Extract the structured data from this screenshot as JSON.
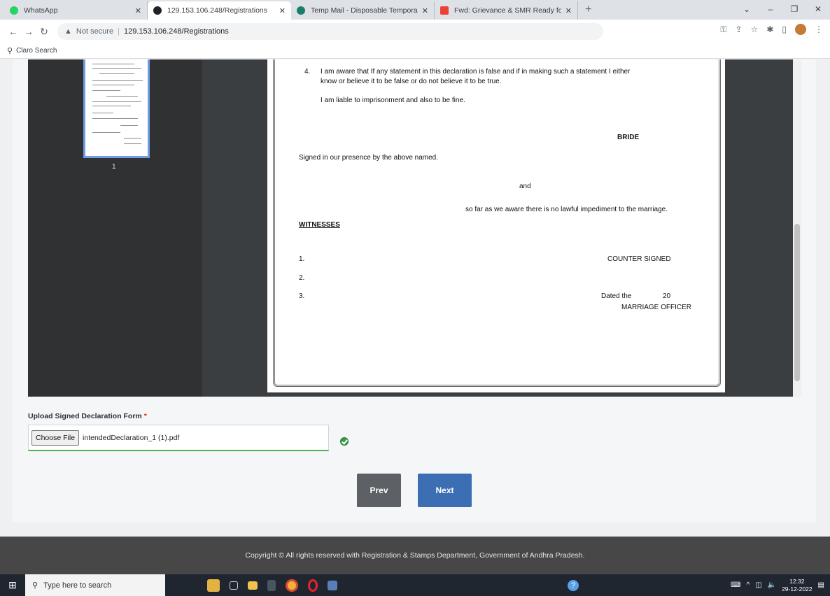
{
  "tabs": [
    {
      "title": "WhatsApp",
      "color": "#25d366"
    },
    {
      "title": "129.153.106.248/Registrations",
      "color": "#202124"
    },
    {
      "title": "Temp Mail - Disposable Tempora",
      "color": "#17806d"
    },
    {
      "title": "Fwd: Grievance & SMR Ready for",
      "color": "#ea4335"
    }
  ],
  "address": {
    "security": "Not secure",
    "url": "129.153.106.248/Registrations"
  },
  "bookmarks": {
    "item": "Claro Search"
  },
  "document": {
    "item4_num": "4.",
    "item4_line1": "I am aware that If any statement in this declaration is false and if in making such a statement I either",
    "item4_line2": "know or believe it to be false or do not believe it to be true.",
    "liable": "I am liable to imprisonment and also to be fine.",
    "bride": "BRIDE",
    "signed": "Signed in our presence by the above named.",
    "and": "and",
    "so_far": "so far as we aware there is no lawful impediment to the marriage.",
    "witnesses": "WITNESSES",
    "w1": "1.",
    "w2": "2.",
    "w3": "3.",
    "counter_signed": "COUNTER SIGNED",
    "dated": "Dated the",
    "year": "20",
    "officer": "MARRIAGE OFFICER"
  },
  "viewer": {
    "page_number": "1"
  },
  "upload": {
    "label": "Upload Signed Declaration Form",
    "required_mark": "*",
    "choose_label": "Choose File",
    "filename": "intendedDeclaration_1 (1).pdf"
  },
  "buttons": {
    "prev": "Prev",
    "next": "Next"
  },
  "footer": {
    "text": "Copyright © All rights reserved with Registration & Stamps Department, Government of Andhra Pradesh."
  },
  "taskbar": {
    "search_placeholder": "Type here to search",
    "time": "12:32",
    "date": "29-12-2022"
  }
}
